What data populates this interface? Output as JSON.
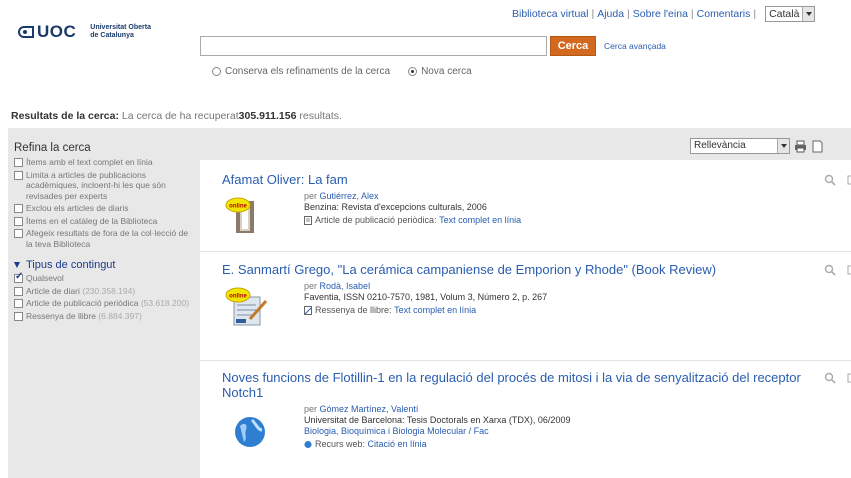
{
  "header": {
    "logo_text": "UOC",
    "logo_sub_line1": "Universitat Oberta",
    "logo_sub_line2": "de Catalunya",
    "links": [
      "Biblioteca virtual",
      "Ajuda",
      "Sobre l'eina",
      "Comentaris"
    ],
    "language": "Català"
  },
  "search": {
    "value": "",
    "button": "Cerca",
    "advanced": "Cerca avançada",
    "radio_keep": "Conserva els refinaments de la cerca",
    "radio_new": "Nova cerca",
    "selected_radio": "Nova cerca"
  },
  "summary": {
    "label": "Resultats de la cerca:",
    "text": "La cerca de ha recuperat",
    "count": "305.911.156",
    "suffix": "resultats."
  },
  "sidebar": {
    "title": "Refina la cerca",
    "filters": [
      "Ítems amb el text complet en línia",
      "Limita a articles de publicacions acadèmiques, incloent-hi les que són revisades per experts",
      "Exclou els articles de diaris",
      "Ítems en el catàleg de la Biblioteca",
      "Afegeix resultats de fora de la col·lecció de la teva Biblioteca"
    ],
    "facet_title": "Tipus de contingut",
    "facet_items": [
      {
        "label": "Qualsevol",
        "count": "",
        "checked": true
      },
      {
        "label": "Article de diari",
        "count": "(230.358.194)",
        "checked": false
      },
      {
        "label": "Article de publicació periòdica",
        "count": "(53.618.200)",
        "checked": false
      },
      {
        "label": "Ressenya de llibre",
        "count": "(6.884.397)",
        "checked": false
      }
    ]
  },
  "sort": {
    "value": "Rellevància"
  },
  "results": [
    {
      "title": "Afamat Oliver: La fam",
      "author": "Gutiérrez, Alex",
      "by": "per",
      "source": "Benzina: Revista d'excepcions culturals, 2006",
      "type": "Article de publicació periòdica:",
      "access": "Text complet en línia",
      "badge": "online"
    },
    {
      "title": "E. Sanmartí Grego, \"La cerámica campaniense de Emporion y Rhode\" (Book Review)",
      "author": "Rodà, Isabel",
      "by": "per",
      "source": "Faventia, ISSN 0210-7570, 1981, Volum 3, Número 2, p. 267",
      "type": "Ressenya de llibre:",
      "access": "Text complet en línia",
      "badge": "online"
    },
    {
      "title": "Noves funcions de Flotillin-1 en la regulació del procés de mitosi i la via de senyalització del receptor Notch1",
      "author": "Gómez Martínez, Valentí",
      "by": "per",
      "source": "Universitat de Barcelona: Tesis Doctorals en Xarxa (TDX), 06/2009",
      "subject": "Biologia, Bioquímica i Biologia Molecular / Fac",
      "type": "Recurs web:",
      "access": "Citació en línia"
    }
  ],
  "colors": {
    "link": "#2a5db0",
    "search_button": "#d2691e",
    "brand": "#1a3a6b"
  }
}
